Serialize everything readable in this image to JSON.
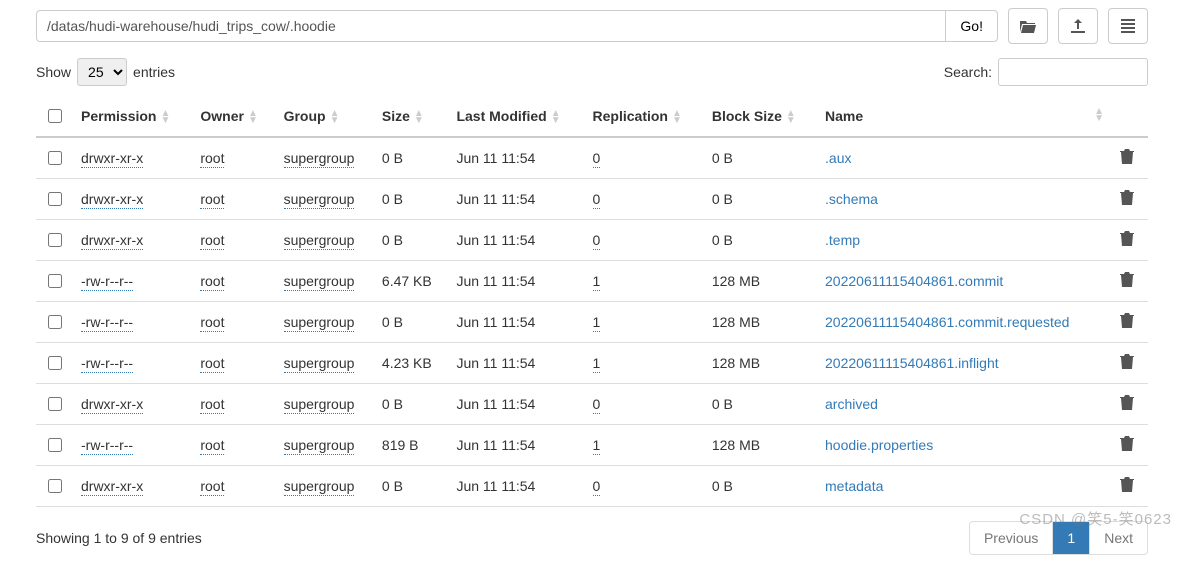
{
  "path": "/datas/hudi-warehouse/hudi_trips_cow/.hoodie",
  "go_label": "Go!",
  "show_prefix": "Show",
  "show_value": "25",
  "show_suffix": "entries",
  "search_label": "Search:",
  "columns": {
    "permission": "Permission",
    "owner": "Owner",
    "group": "Group",
    "size": "Size",
    "lastmod": "Last Modified",
    "replication": "Replication",
    "blocksize": "Block Size",
    "name": "Name"
  },
  "rows": [
    {
      "permission": "drwxr-xr-x",
      "owner": "root",
      "group": "supergroup",
      "size": "0 B",
      "lastmod": "Jun 11 11:54",
      "replication": "0",
      "blocksize": "0 B",
      "name": ".aux"
    },
    {
      "permission": "drwxr-xr-x",
      "owner": "root",
      "group": "supergroup",
      "size": "0 B",
      "lastmod": "Jun 11 11:54",
      "replication": "0",
      "blocksize": "0 B",
      "name": ".schema"
    },
    {
      "permission": "drwxr-xr-x",
      "owner": "root",
      "group": "supergroup",
      "size": "0 B",
      "lastmod": "Jun 11 11:54",
      "replication": "0",
      "blocksize": "0 B",
      "name": ".temp"
    },
    {
      "permission": "-rw-r--r--",
      "owner": "root",
      "group": "supergroup",
      "size": "6.47 KB",
      "lastmod": "Jun 11 11:54",
      "replication": "1",
      "blocksize": "128 MB",
      "name": "20220611115404861.commit"
    },
    {
      "permission": "-rw-r--r--",
      "owner": "root",
      "group": "supergroup",
      "size": "0 B",
      "lastmod": "Jun 11 11:54",
      "replication": "1",
      "blocksize": "128 MB",
      "name": "20220611115404861.commit.requested"
    },
    {
      "permission": "-rw-r--r--",
      "owner": "root",
      "group": "supergroup",
      "size": "4.23 KB",
      "lastmod": "Jun 11 11:54",
      "replication": "1",
      "blocksize": "128 MB",
      "name": "20220611115404861.inflight"
    },
    {
      "permission": "drwxr-xr-x",
      "owner": "root",
      "group": "supergroup",
      "size": "0 B",
      "lastmod": "Jun 11 11:54",
      "replication": "0",
      "blocksize": "0 B",
      "name": "archived"
    },
    {
      "permission": "-rw-r--r--",
      "owner": "root",
      "group": "supergroup",
      "size": "819 B",
      "lastmod": "Jun 11 11:54",
      "replication": "1",
      "blocksize": "128 MB",
      "name": "hoodie.properties"
    },
    {
      "permission": "drwxr-xr-x",
      "owner": "root",
      "group": "supergroup",
      "size": "0 B",
      "lastmod": "Jun 11 11:54",
      "replication": "0",
      "blocksize": "0 B",
      "name": "metadata"
    }
  ],
  "footer_text": "Showing 1 to 9 of 9 entries",
  "pager": {
    "prev": "Previous",
    "page": "1",
    "next": "Next"
  },
  "watermark": "CSDN @笑5-笑0623"
}
